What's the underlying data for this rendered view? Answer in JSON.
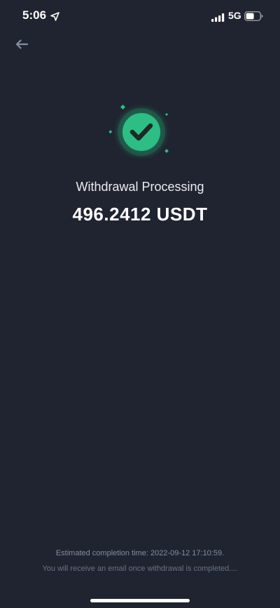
{
  "status_bar": {
    "time": "5:06",
    "network": "5G",
    "location_icon": "location-arrow-icon",
    "signal_icon": "cellular-signal-icon",
    "battery_icon": "battery-icon"
  },
  "header": {
    "back_icon": "back-arrow-icon"
  },
  "result": {
    "icon": "check-circle-icon",
    "title": "Withdrawal Processing",
    "amount": "496.2412 USDT"
  },
  "footer": {
    "estimate": "Estimated completion time: 2022-09-12 17:10:59.",
    "email_note": "You will receive an email once withdrawal is completed...."
  },
  "colors": {
    "background": "#1f2430",
    "success_green": "#2ebd85",
    "muted_text": "#848e9c"
  }
}
